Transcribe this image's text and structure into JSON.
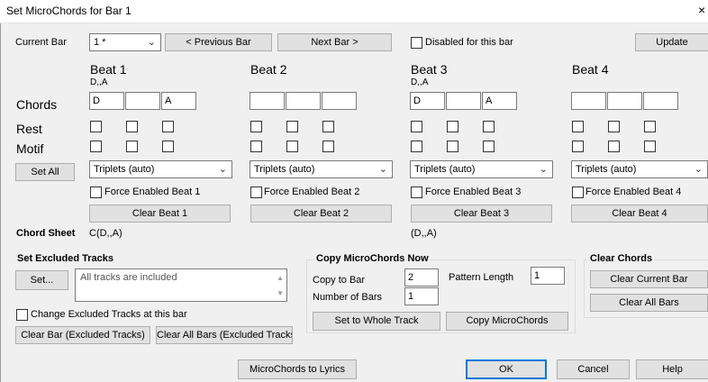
{
  "window": {
    "title": "Set MicroChords for Bar 1",
    "close": "×"
  },
  "top": {
    "current_bar_label": "Current Bar",
    "current_bar_value": "1 *",
    "prev_button": "< Previous Bar",
    "next_button": "Next Bar >",
    "disabled_label": "Disabled for this bar",
    "update_button": "Update"
  },
  "row_labels": {
    "chords": "Chords",
    "rest": "Rest",
    "motif": "Motif"
  },
  "set_all_button": "Set All",
  "beats": [
    {
      "title": "Beat 1",
      "chord_display": "D,,A",
      "chords": [
        "D",
        "",
        "A"
      ],
      "triplets": "Triplets (auto)",
      "force_label": "Force Enabled Beat 1",
      "clear_button": "Clear Beat 1"
    },
    {
      "title": "Beat 2",
      "chord_display": "",
      "chords": [
        "",
        "",
        ""
      ],
      "triplets": "Triplets (auto)",
      "force_label": "Force Enabled Beat 2",
      "clear_button": "Clear Beat 2"
    },
    {
      "title": "Beat 3",
      "chord_display": "D,,A",
      "chords": [
        "D",
        "",
        "A"
      ],
      "triplets": "Triplets (auto)",
      "force_label": "Force Enabled Beat 3",
      "clear_button": "Clear Beat 3"
    },
    {
      "title": "Beat 4",
      "chord_display": "",
      "chords": [
        "",
        "",
        ""
      ],
      "triplets": "Triplets (auto)",
      "force_label": "Force Enabled Beat 4",
      "clear_button": "Clear Beat 4"
    }
  ],
  "chord_sheet": {
    "label": "Chord Sheet",
    "value1": "C(D,,A)",
    "value2": "(D,,A)"
  },
  "excluded": {
    "title": "Set Excluded Tracks",
    "set_button": "Set...",
    "memo": "All tracks are included",
    "change_label": "Change Excluded Tracks at this bar",
    "clear_bar_button": "Clear Bar (Excluded Tracks)",
    "clear_all_button": "Clear All Bars (Excluded Tracks)"
  },
  "copy": {
    "title": "Copy MicroChords Now",
    "copy_to_label": "Copy to Bar",
    "copy_to_value": "2",
    "pattern_label": "Pattern Length",
    "pattern_value": "1",
    "num_bars_label": "Number of Bars",
    "num_bars_value": "1",
    "set_whole_button": "Set to Whole Track",
    "copy_button": "Copy MicroChords"
  },
  "clear_chords": {
    "title": "Clear Chords",
    "current_button": "Clear Current Bar",
    "all_button": "Clear All Bars"
  },
  "bottom": {
    "lyrics_button": "MicroChords to Lyrics",
    "ok_button": "OK",
    "cancel_button": "Cancel",
    "help_button": "Help"
  }
}
